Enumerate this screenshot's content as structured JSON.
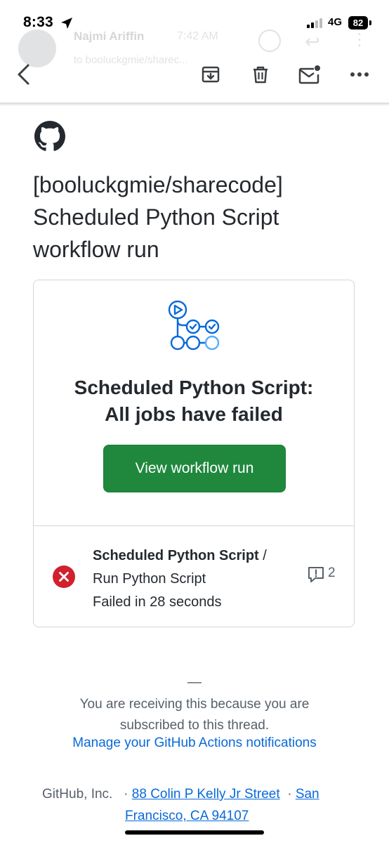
{
  "status_bar": {
    "time": "8:33",
    "network": "4G",
    "battery": "82"
  },
  "sender": {
    "name": "Najmi Ariffin",
    "time": "7:42 AM",
    "to": "to booluckgmie/sharec..."
  },
  "email": {
    "subject": "[booluckgmie/sharecode] Scheduled Python Script workflow run"
  },
  "card": {
    "title_line1": "Scheduled Python Script:",
    "title_line2": "All jobs have failed",
    "button_label": "View workflow run",
    "job": {
      "workflow": "Scheduled Python Script",
      "separator": " /",
      "name": "Run Python Script",
      "status": "Failed in 28 seconds",
      "annotation_count": "2"
    }
  },
  "footer": {
    "dash": "—",
    "notice": "You are receiving this because you are subscribed to this thread.",
    "manage_link": "Manage your GitHub Actions notifications",
    "company": "GitHub, Inc.",
    "dot": "·",
    "address_line": "88 Colin P Kelly Jr Street",
    "city_part1": "San",
    "city_part2": "Francisco, CA 94107"
  },
  "colors": {
    "primary_button": "#1f883d",
    "failure": "#cf222e",
    "link": "#0969da",
    "actions_blue": "#0969da"
  }
}
